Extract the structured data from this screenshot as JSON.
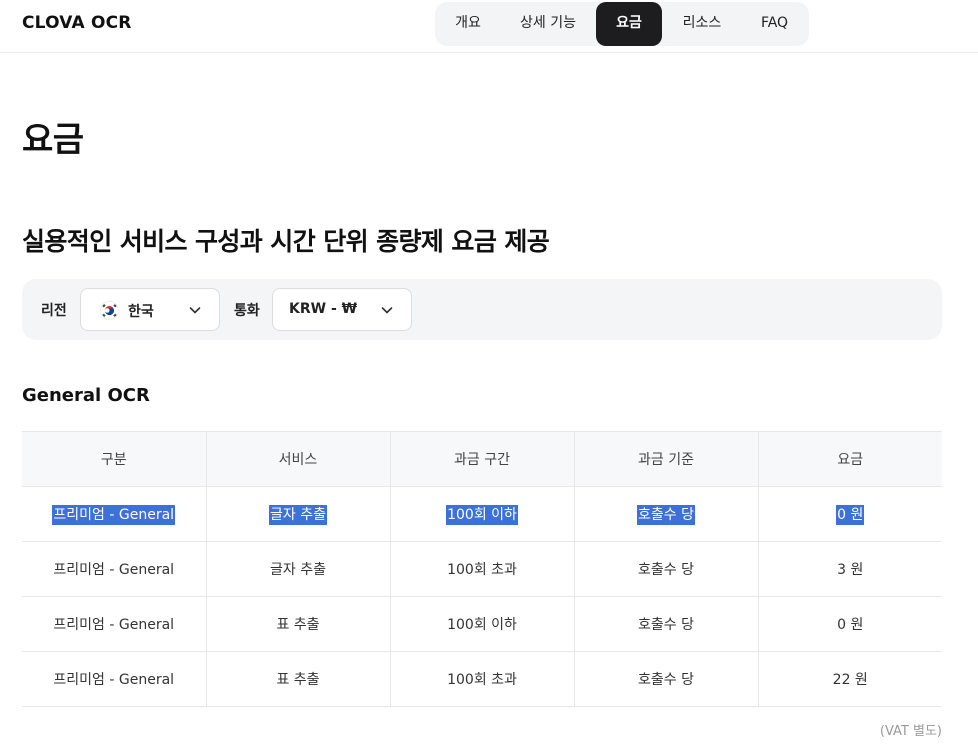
{
  "header": {
    "logo": "CLOVA OCR",
    "nav": [
      {
        "label": "개요",
        "active": false
      },
      {
        "label": "상세 기능",
        "active": false
      },
      {
        "label": "요금",
        "active": true
      },
      {
        "label": "리소스",
        "active": false
      },
      {
        "label": "FAQ",
        "active": false
      }
    ]
  },
  "page": {
    "title": "요금",
    "subtitle": "실용적인 서비스 구성과 시간 단위 종량제 요금 제공"
  },
  "filters": {
    "region_label": "리전",
    "region_value": "한국",
    "currency_label": "통화",
    "currency_value": "KRW - ₩"
  },
  "section": {
    "title": "General OCR"
  },
  "table": {
    "headers": [
      "구분",
      "서비스",
      "과금 구간",
      "과금 기준",
      "요금"
    ],
    "rows": [
      [
        "프리미엄 - General",
        "글자 추출",
        "100회 이하",
        "호출수 당",
        "0 원"
      ],
      [
        "프리미엄 - General",
        "글자 추출",
        "100회 초과",
        "호출수 당",
        "3 원"
      ],
      [
        "프리미엄 - General",
        "표 추출",
        "100회 이하",
        "호출수 당",
        "0 원"
      ],
      [
        "프리미엄 - General",
        "표 추출",
        "100회 초과",
        "호출수 당",
        "22 원"
      ]
    ],
    "highlighted_row": 0
  },
  "footnote": "(VAT 별도)",
  "colors": {
    "accent_dark": "#1d1d1f",
    "selection": "#3d70d8",
    "panel": "#f4f5f7"
  }
}
